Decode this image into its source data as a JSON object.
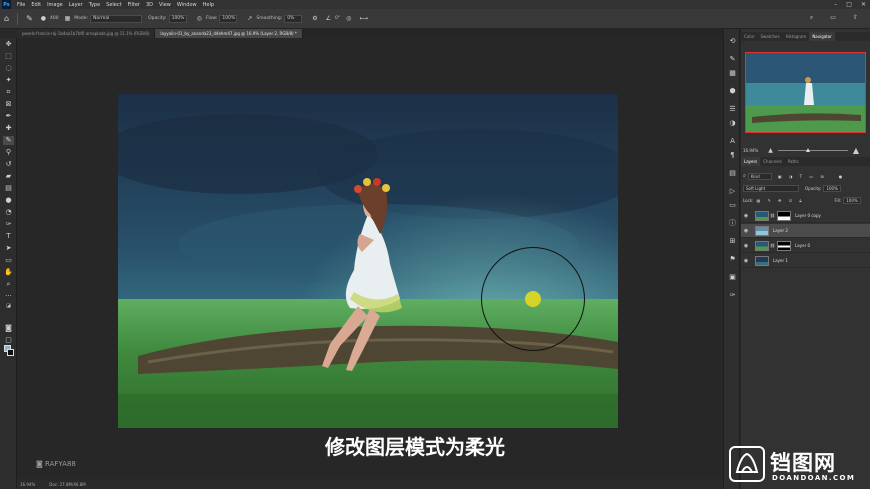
{
  "app": {
    "logo": "Ps"
  },
  "menu": [
    "File",
    "Edit",
    "Image",
    "Layer",
    "Type",
    "Select",
    "Filter",
    "3D",
    "View",
    "Window",
    "Help"
  ],
  "options_bar": {
    "mode_label": "Mode:",
    "mode_value": "Normal",
    "opacity_label": "Opacity:",
    "opacity_value": "100%",
    "flow_label": "Flow:",
    "flow_value": "100%",
    "smoothing_label": "Smoothing:",
    "smoothing_value": "0%",
    "angle_value": "0°",
    "brush_size": "400"
  },
  "doc_tabs": [
    {
      "label": "pexels-francis-raj-1b4aa1b7bf0 arnaplado.jpg @ 11.1% (RGB/8)",
      "active": false
    },
    {
      "label": "layyalin-01_by_ananda23_d4ehm47.jpg @ 16.9% (Layer 2, RGB/8) *",
      "active": true
    }
  ],
  "status": {
    "zoom": "16.94%",
    "doc": "Doc: 27.8M/46.8M"
  },
  "subtitle": "修改图层模式为柔光",
  "watermark": "RAFYA88",
  "panel_tabs_top": [
    {
      "label": "Color",
      "active": false
    },
    {
      "label": "Swatches",
      "active": false
    },
    {
      "label": "Histogram",
      "active": false
    },
    {
      "label": "Navigator",
      "active": true
    }
  ],
  "navigator": {
    "zoom": "16.94%"
  },
  "layers_panel": {
    "tabs": [
      {
        "label": "Layers",
        "active": true
      },
      {
        "label": "Channels",
        "active": false
      },
      {
        "label": "Paths",
        "active": false
      }
    ],
    "filter_kind": "Kind",
    "blend_mode": "Soft Light",
    "opacity_label": "Opacity:",
    "opacity_value": "100%",
    "lock_label": "Lock:",
    "fill_label": "Fill:",
    "fill_value": "100%",
    "layers": [
      {
        "name": "Layer 0 copy",
        "selected": false,
        "has_mask": true
      },
      {
        "name": "Layer 2",
        "selected": true,
        "has_mask": false
      },
      {
        "name": "Layer 0",
        "selected": false,
        "has_mask": true
      },
      {
        "name": "Layer 1",
        "selected": false,
        "has_mask": false
      }
    ]
  },
  "branding": {
    "cn": "铛图网",
    "en": "DOANDOAN.COM"
  }
}
